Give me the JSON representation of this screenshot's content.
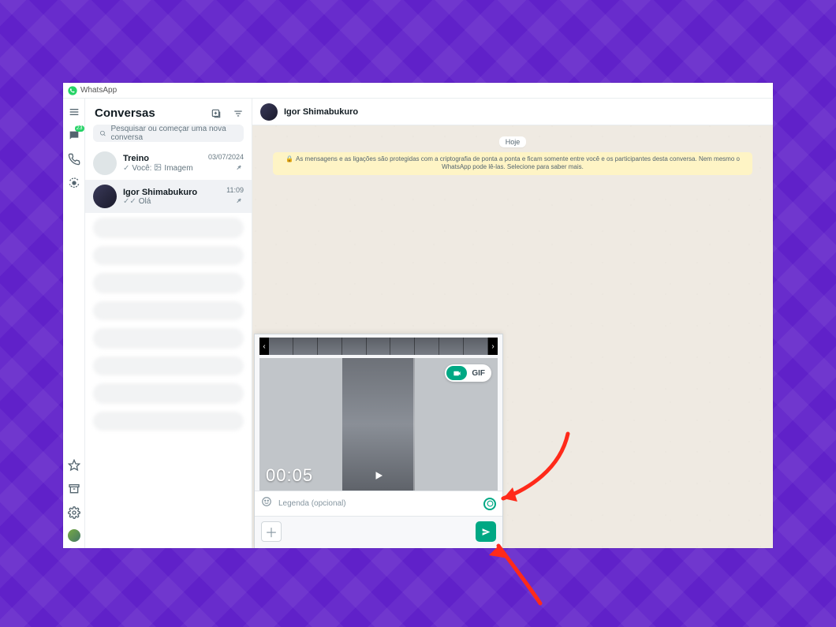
{
  "app": {
    "title": "WhatsApp"
  },
  "rail": {
    "chats_badge": "23"
  },
  "sidebar": {
    "title": "Conversas",
    "search_placeholder": "Pesquisar ou começar uma nova conversa"
  },
  "chats": [
    {
      "name": "Treino",
      "preview_prefix": "Você:",
      "preview_media": "Imagem",
      "time": "03/07/2024",
      "pinned": true,
      "active": false
    },
    {
      "name": "Igor Shimabukuro",
      "preview_text": "Olá",
      "time": "11:09",
      "pinned": true,
      "active": true
    }
  ],
  "conversation": {
    "contact_name": "Igor Shimabukuro",
    "date_label": "Hoje",
    "encryption_notice": "As mensagens e as ligações são protegidas com a criptografia de ponta a ponta e ficam somente entre você e os participantes desta conversa. Nem mesmo o WhatsApp pode lê-las. Selecione para saber mais."
  },
  "attachment": {
    "duration_label": "00:05",
    "gif_label": "GIF",
    "caption_placeholder": "Legenda (opcional)",
    "quality_badge": "Q"
  }
}
